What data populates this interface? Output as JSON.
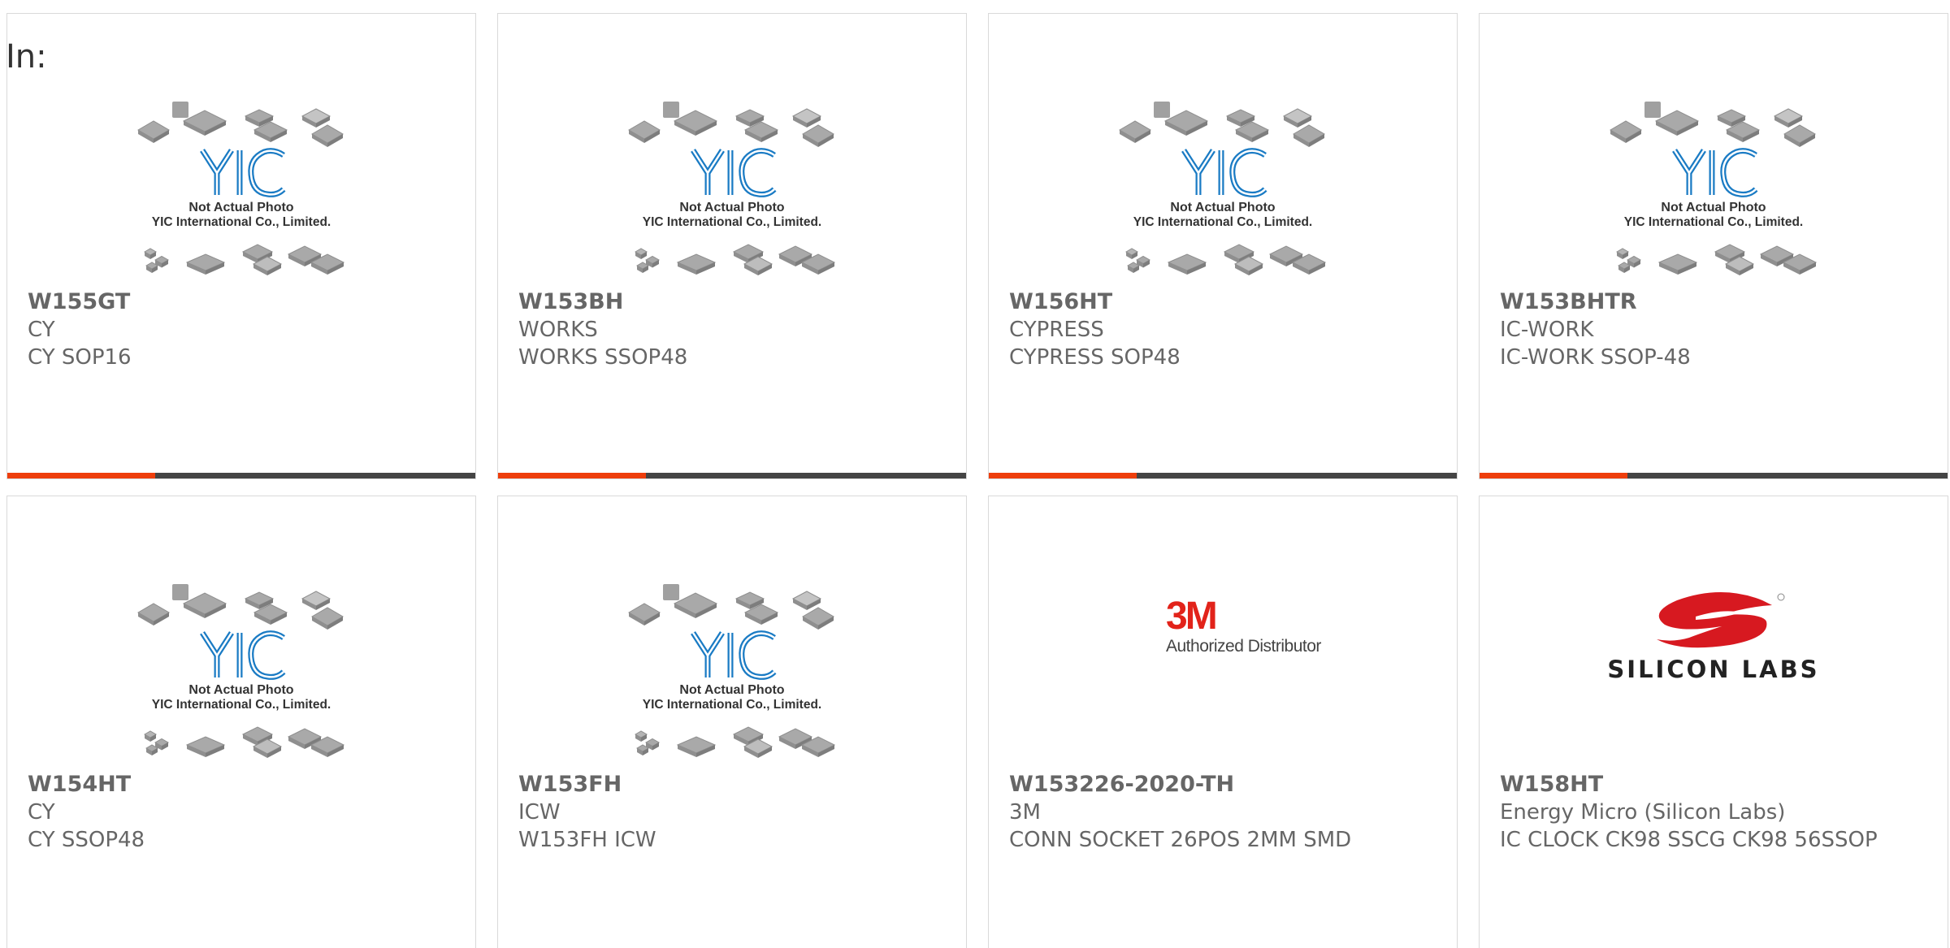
{
  "in_label": "In:",
  "placeholder_image": {
    "line1": "Not Actual Photo",
    "line2": "YIC International Co., Limited.",
    "logo_text": "YIC"
  },
  "brand_logos": {
    "three_m": {
      "mark": "3M",
      "caption": "Authorized Distributor",
      "color": "#e2231a"
    },
    "silicon_labs": {
      "caption": "SILICON LABS",
      "color": "#d71920"
    }
  },
  "colors": {
    "accent": "#ee3e0c",
    "bar": "#444444",
    "text": "#666666",
    "yic_blue": "#1a7bc4"
  },
  "products": [
    {
      "part": "W155GT",
      "manufacturer": "CY",
      "description": "CY SOP16",
      "image": "yic-placeholder"
    },
    {
      "part": "W153BH",
      "manufacturer": "WORKS",
      "description": "WORKS SSOP48",
      "image": "yic-placeholder"
    },
    {
      "part": "W156HT",
      "manufacturer": "CYPRESS",
      "description": "CYPRESS SOP48",
      "image": "yic-placeholder"
    },
    {
      "part": "W153BHTR",
      "manufacturer": "IC-WORK",
      "description": "IC-WORK SSOP-48",
      "image": "yic-placeholder"
    },
    {
      "part": "W154HT",
      "manufacturer": "CY",
      "description": "CY SSOP48",
      "image": "yic-placeholder"
    },
    {
      "part": "W153FH",
      "manufacturer": "ICW",
      "description": "W153FH ICW",
      "image": "yic-placeholder"
    },
    {
      "part": "W153226-2020-TH",
      "manufacturer": "3M",
      "description": "CONN SOCKET 26POS 2MM SMD",
      "image": "3m-logo"
    },
    {
      "part": "W158HT",
      "manufacturer": "Energy Micro (Silicon Labs)",
      "description": "IC CLOCK CK98 SSCG CK98 56SSOP",
      "image": "silicon-labs-logo"
    }
  ]
}
